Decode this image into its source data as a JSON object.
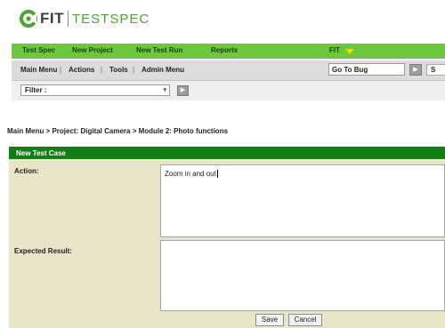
{
  "logo": {
    "word1": "FIT",
    "word2": "TESTSPEC"
  },
  "colors": {
    "nav_green": "#6bc93b",
    "panel_header": "#147c14",
    "panel_bg": "#e9e5c9",
    "brand_green": "#4aa531"
  },
  "topnav": {
    "items": [
      "Test Spec",
      "New Project",
      "New Test Run",
      "Reports"
    ],
    "fit_label": "FIT"
  },
  "subnav": {
    "items": [
      "Main Menu",
      "Actions",
      "Tools",
      "Admin Menu"
    ],
    "separator": "|",
    "go_to_bug_value": "Go To Bug",
    "go_icon": "arrow-right-icon",
    "extra_label": "S"
  },
  "filter": {
    "value": "Filter :",
    "chevron": "▾",
    "go_icon": "arrow-right-icon"
  },
  "breadcrumb": "Main Menu > Project: Digital Camera > Module 2: Photo functions",
  "form": {
    "title": "New Test Case",
    "action_label": "Action:",
    "action_value": "Zoom in and out",
    "expected_label": "Expected Result:",
    "expected_value": "",
    "save_label": "Save",
    "cancel_label": "Cancel"
  }
}
